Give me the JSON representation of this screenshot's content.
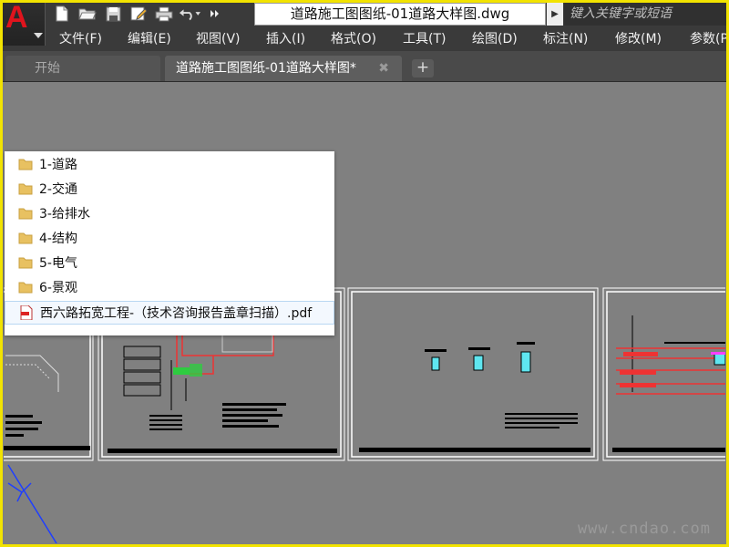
{
  "quick_access": {
    "icons": [
      "new-icon",
      "open-icon",
      "save-icon",
      "save-as-icon",
      "print-icon",
      "undo-icon",
      "more-icon"
    ]
  },
  "title": {
    "document": "道路施工图图纸-01道路大样图.dwg"
  },
  "search": {
    "placeholder": "键入关键字或短语"
  },
  "menu": {
    "items": [
      "文件(F)",
      "编辑(E)",
      "视图(V)",
      "插入(I)",
      "格式(O)",
      "工具(T)",
      "绘图(D)",
      "标注(N)",
      "修改(M)",
      "参数(P"
    ]
  },
  "tabs": {
    "start": "开始",
    "active": "道路施工图图纸-01道路大样图*",
    "close": "✖",
    "add": "+"
  },
  "file_list": {
    "items": [
      {
        "type": "folder",
        "label": "1-道路"
      },
      {
        "type": "folder",
        "label": "2-交通"
      },
      {
        "type": "folder",
        "label": "3-给排水"
      },
      {
        "type": "folder",
        "label": "4-结构"
      },
      {
        "type": "folder",
        "label": "5-电气"
      },
      {
        "type": "folder",
        "label": "6-景观"
      },
      {
        "type": "pdf",
        "label": "西六路拓宽工程-（技术咨询报告盖章扫描）.pdf"
      }
    ]
  },
  "watermark": "www.cndao.com",
  "colors": {
    "accent_frame": "#f2e300",
    "logo_red": "#e0141d",
    "menubar": "#3a3a3a",
    "canvas": "#808080",
    "folder": "#e8c161"
  }
}
